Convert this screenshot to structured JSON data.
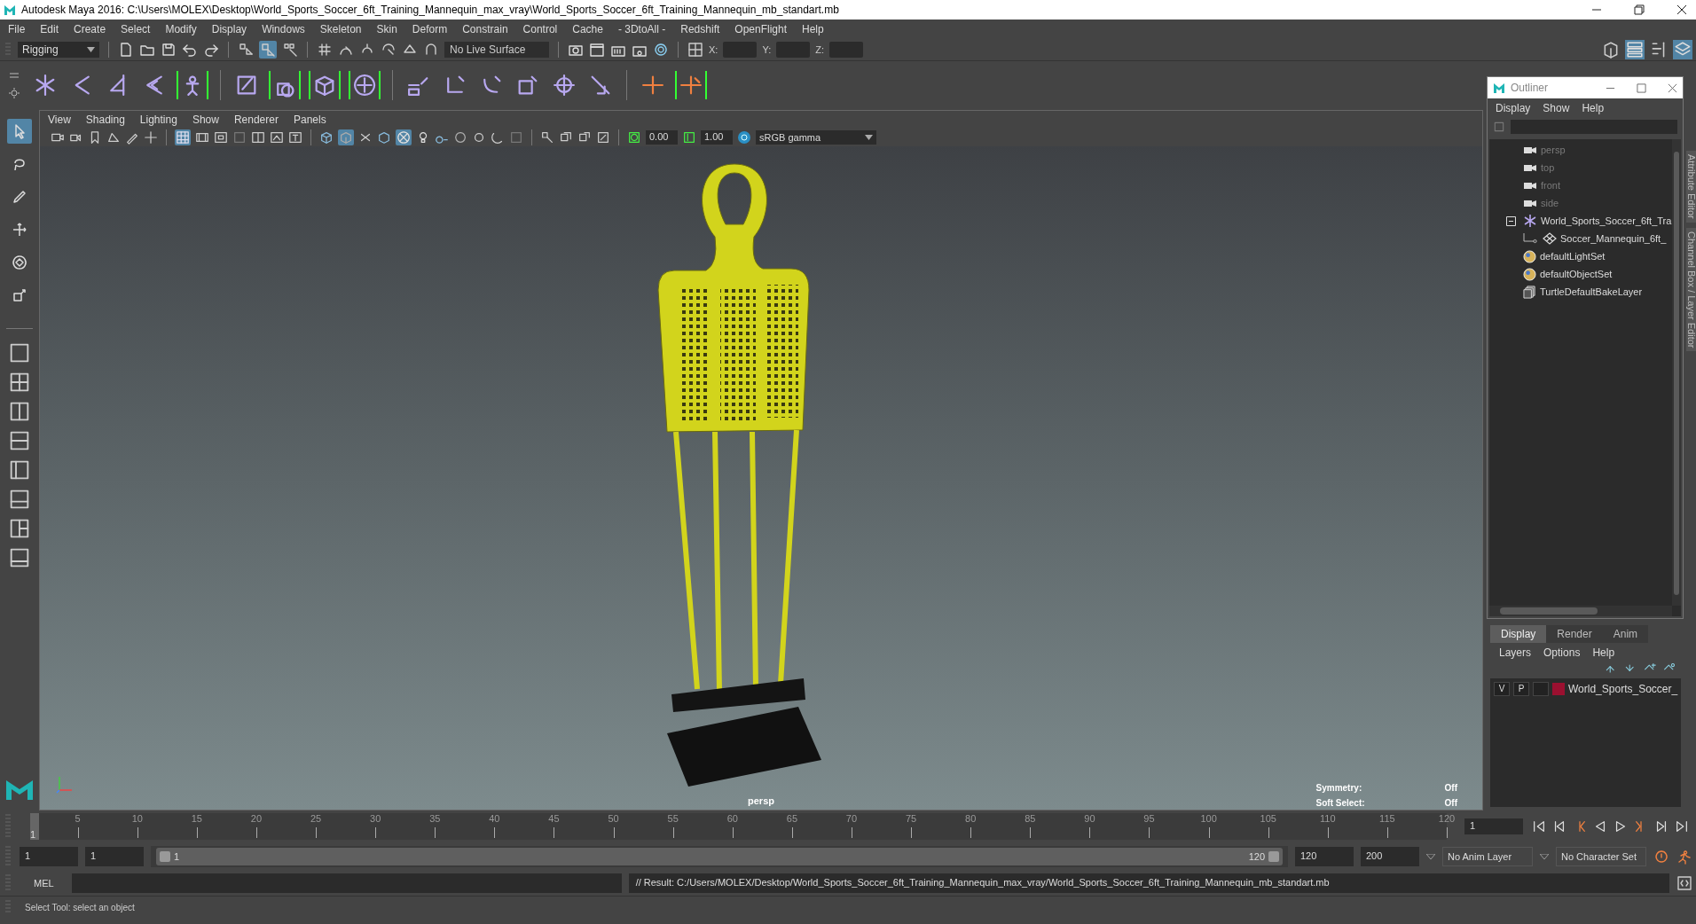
{
  "window": {
    "title": "Autodesk Maya 2016: C:\\Users\\MOLEX\\Desktop\\World_Sports_Soccer_6ft_Training_Mannequin_max_vray\\World_Sports_Soccer_6ft_Training_Mannequin_mb_standart.mb"
  },
  "menu_bar": [
    "File",
    "Edit",
    "Create",
    "Select",
    "Modify",
    "Display",
    "Windows",
    "Skeleton",
    "Skin",
    "Deform",
    "Constrain",
    "Control",
    "Cache",
    "- 3DtoAll -",
    "Redshift",
    "OpenFlight",
    "Help"
  ],
  "status_line": {
    "menu_set": "Rigging",
    "live_surface": "No Live Surface",
    "coordinates": [
      {
        "label": "X:"
      },
      {
        "label": "Y:"
      },
      {
        "label": "Z:"
      }
    ]
  },
  "tool_box": [
    {
      "kind": "select",
      "selected": true
    },
    {
      "kind": "lasso",
      "selected": false
    },
    {
      "kind": "paint",
      "selected": false
    },
    {
      "kind": "move",
      "selected": false
    },
    {
      "kind": "rotate",
      "selected": false
    },
    {
      "kind": "scale",
      "selected": false
    }
  ],
  "viewport": {
    "menus": [
      "View",
      "Shading",
      "Lighting",
      "Show",
      "Renderer",
      "Panels"
    ],
    "exposure": "0.00",
    "gamma": "1.00",
    "color_space": "sRGB gamma",
    "camera": "persp",
    "hud": [
      {
        "label": "Symmetry:",
        "value": "Off"
      },
      {
        "label": "Soft Select:",
        "value": "Off"
      }
    ]
  },
  "outliner": {
    "title": "Outliner",
    "menus": [
      "Display",
      "Show",
      "Help"
    ],
    "items": [
      {
        "kind": "camera",
        "label": "persp",
        "dimmed": true
      },
      {
        "kind": "camera",
        "label": "top",
        "dimmed": true
      },
      {
        "kind": "camera",
        "label": "front",
        "dimmed": true
      },
      {
        "kind": "camera",
        "label": "side",
        "dimmed": true
      },
      {
        "kind": "group",
        "label": "World_Sports_Soccer_6ft_Tra",
        "dimmed": false,
        "expanded": true,
        "children": [
          {
            "kind": "mesh",
            "label": "Soccer_Mannequin_6ft_",
            "dimmed": false
          }
        ]
      },
      {
        "kind": "set",
        "label": "defaultLightSet",
        "dimmed": false
      },
      {
        "kind": "set",
        "label": "defaultObjectSet",
        "dimmed": false
      },
      {
        "kind": "layer",
        "label": "TurtleDefaultBakeLayer",
        "dimmed": false
      }
    ]
  },
  "side_tabs": [
    "Attribute Editor",
    "Channel Box / Layer Editor"
  ],
  "layer_editor": {
    "tabs": [
      {
        "label": "Display",
        "selected": true
      },
      {
        "label": "Render",
        "selected": false
      },
      {
        "label": "Anim",
        "selected": false
      }
    ],
    "menus": [
      "Layers",
      "Options",
      "Help"
    ],
    "layers": [
      {
        "visibility": "V",
        "playback": "P",
        "color": "#9b1030",
        "name": "World_Sports_Soccer_"
      }
    ]
  },
  "time_slider": {
    "labels": [
      "5",
      "10",
      "15",
      "20",
      "25",
      "30",
      "35",
      "40",
      "45",
      "50",
      "55",
      "60",
      "65",
      "70",
      "75",
      "80",
      "85",
      "90",
      "95",
      "100",
      "105",
      "110",
      "115",
      "120"
    ],
    "current": "1",
    "current_frame": "1"
  },
  "range_slider": {
    "level": 1,
    "start": "1",
    "range_start": "1",
    "handle_start": "1",
    "handle_end": "120",
    "range_end": "120",
    "end": "200",
    "anim_layer": "No Anim Layer",
    "character_set": "No Character Set"
  },
  "command_line": {
    "language": "MEL",
    "result": "// Result: C:/Users/MOLEX/Desktop/World_Sports_Soccer_6ft_Training_Mannequin_max_vray/World_Sports_Soccer_6ft_Training_Mannequin_mb_standart.mb"
  },
  "help_line": "Select Tool: select an object"
}
